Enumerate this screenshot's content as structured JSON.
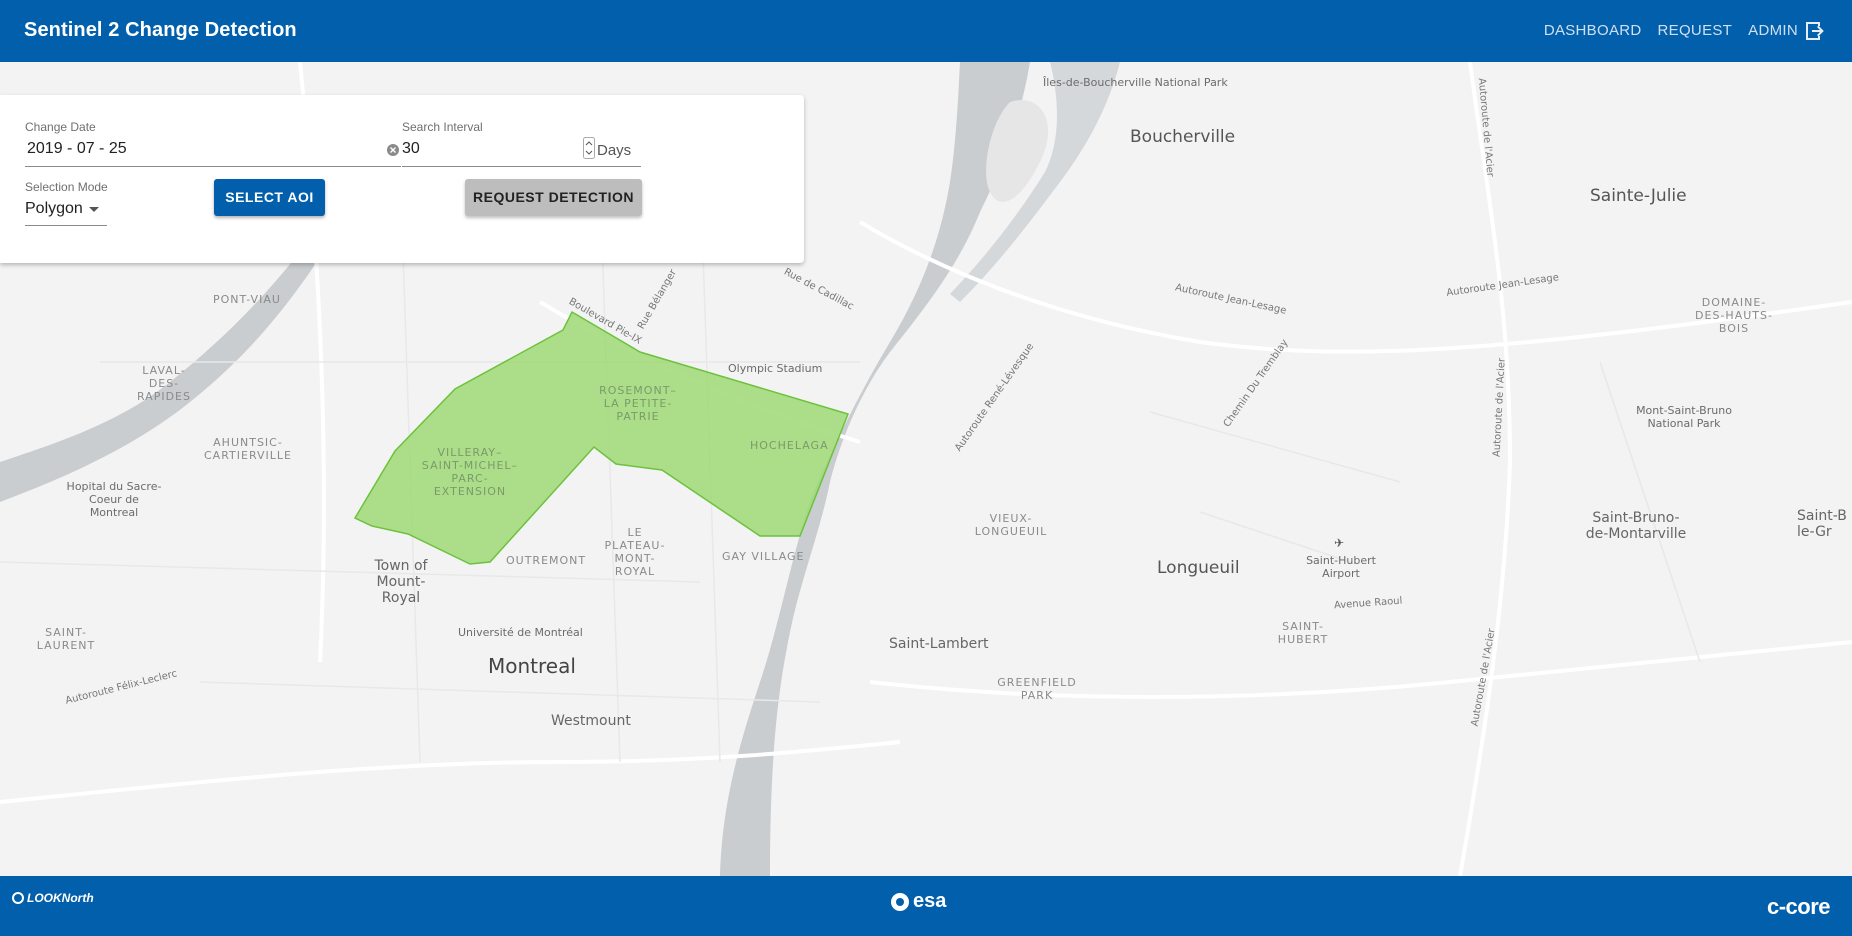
{
  "header": {
    "title": "Sentinel 2 Change Detection",
    "nav": [
      "DASHBOARD",
      "REQUEST",
      "ADMIN"
    ],
    "logout_icon": "logout-icon"
  },
  "form": {
    "change_date_label": "Change Date",
    "change_date_value": "2019 - 07 - 25",
    "search_interval_label": "Search Interval",
    "search_interval_value": "30",
    "days_label": "Days",
    "selection_mode_label": "Selection Mode",
    "selection_mode_value": "Polygon",
    "select_aoi_label": "SELECT AOI",
    "request_detection_label": "REQUEST DETECTION"
  },
  "map": {
    "aoi_fill": "#9fd977",
    "aoi_stroke": "#6cc23c",
    "water": "#c9cdcf",
    "labels": {
      "boucherville": "Boucherville",
      "sainte_julie": "Sainte-Julie",
      "iles_park": "Îles-de-Boucherville National Park",
      "longueuil": "Longueuil",
      "montreal": "Montreal",
      "westmount": "Westmount",
      "saint_lambert": "Saint-Lambert",
      "town_mount_royal": "Town of Mount-Royal",
      "saint_bruno": "Saint-Bruno-de-Montarville",
      "mont_saint_bruno": "Mont-Saint-Bruno National Park",
      "olympic_stadium": "Olympic Stadium",
      "universite": "Université de Montréal",
      "hopital": "Hopital du Sacre-Coeur de Montreal",
      "airport": "Saint-Hubert Airport",
      "pont_viau": "PONT-VIAU",
      "laval": "LAVAL-DES-RAPIDES",
      "ahuntsic": "AHUNTSIC-CARTIERVILLE",
      "saint_laurent": "SAINT-LAURENT",
      "rosemont": "ROSEMONT–LA PETITE-PATRIE",
      "villeray": "VILLERAY–SAINT-MICHEL–PARC-EXTENSION",
      "hochelaga": "HOCHELAGA",
      "plateau": "LE PLATEAU-MONT-ROYAL",
      "gay_village": "GAY VILLAGE",
      "outremont": "OUTREMONT",
      "vieux_longueuil": "VIEUX-LONGUEUIL",
      "greenfield": "GREENFIELD PARK",
      "saint_hubert": "SAINT-HUBERT",
      "domaine": "DOMAINE-DES-HAUTS-BOIS",
      "saint_b_right": "Saint-B le-Gr",
      "rd_jean_lesage_1": "Autoroute Jean-Lesage",
      "rd_jean_lesage_2": "Autoroute Jean-Lesage",
      "rd_cadillac": "Rue de Cadillac",
      "rd_pie_ix": "Boulevard Pie-IX",
      "rd_belanger": "Rue Bélanger",
      "rd_tremblay": "Chemin Du Tremblay",
      "rd_rene_levesque": "Autoroute René-Lévesque",
      "rd_acier_1": "Autoroute de l'Acier",
      "rd_acier_2": "Autoroute de l'Acier",
      "rd_acier_3": "Autoroute de l'Acier",
      "rd_raoul": "Avenue Raoul",
      "rd_felix": "Autoroute Félix-Leclerc"
    }
  },
  "footer": {
    "left_logo": "LOOKNorth",
    "center_logo": "esa",
    "right_logo": "c-core"
  }
}
